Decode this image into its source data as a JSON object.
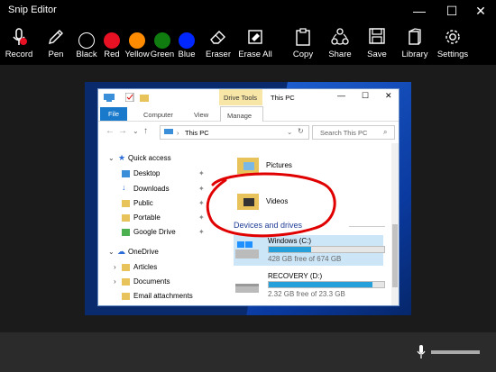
{
  "app": {
    "title": "Snip Editor"
  },
  "window_controls": {
    "minimize": "—",
    "maximize": "☐",
    "close": "✕"
  },
  "toolbar": {
    "record": "Record",
    "pen": "Pen",
    "black": "Black",
    "red": "Red",
    "yellow": "Yellow",
    "green": "Green",
    "blue": "Blue",
    "eraser": "Eraser",
    "erase_all": "Erase All",
    "copy": "Copy",
    "share": "Share",
    "save": "Save",
    "library": "Library",
    "settings": "Settings"
  },
  "colors": {
    "black": "#000000",
    "red": "#e81123",
    "yellow": "#ff8c00",
    "green": "#107c10",
    "blue": "#0027ff",
    "annotation": "#e00000"
  },
  "explorer": {
    "ribbon_context": "Drive Tools",
    "window_title": "This PC",
    "tabs": {
      "file": "File",
      "computer": "Computer",
      "view": "View",
      "manage": "Manage"
    },
    "address": "This PC",
    "search_placeholder": "Search This PC",
    "nav": {
      "quick_access": "Quick access",
      "desktop": "Desktop",
      "downloads": "Downloads",
      "public": "Public",
      "portable": "Portable",
      "google_drive": "Google Drive",
      "onedrive": "OneDrive",
      "articles": "Articles",
      "documents": "Documents",
      "email_attachments": "Email attachments"
    },
    "folders": {
      "pictures": "Pictures",
      "videos": "Videos"
    },
    "section": "Devices and drives",
    "drives": [
      {
        "name": "Windows (C:)",
        "free": "428 GB free of 674 GB",
        "used_fraction": 0.365
      },
      {
        "name": "RECOVERY (D:)",
        "free": "2.32 GB free of 23.3 GB",
        "used_fraction": 0.9
      }
    ]
  }
}
